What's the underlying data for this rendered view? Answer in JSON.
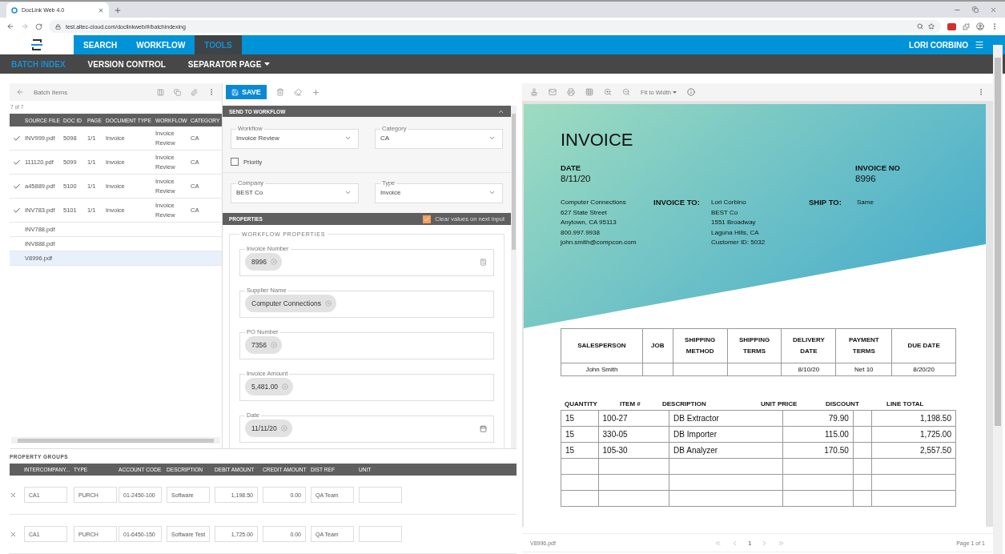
{
  "browser": {
    "tab_title": "DocLink Web 4.0",
    "url": "test.altec-cloud.com/doclinkweb/#/batchindexing"
  },
  "nav": {
    "items": [
      {
        "label": "SEARCH",
        "selected": false
      },
      {
        "label": "WORKFLOW",
        "selected": false
      },
      {
        "label": "TOOLS",
        "selected": true
      }
    ],
    "user": "LORI CORBINO"
  },
  "subnav": [
    {
      "label": "BATCH INDEX",
      "selected": true,
      "dropdown": false
    },
    {
      "label": "VERSION CONTROL",
      "selected": false,
      "dropdown": false
    },
    {
      "label": "SEPARATOR PAGE",
      "selected": false,
      "dropdown": true
    }
  ],
  "batch": {
    "title": "Batch Items",
    "count": "7 of 7",
    "columns": [
      "SOURCE FILE",
      "DOC ID",
      "PAGE",
      "DOCUMENT TYPE",
      "WORKFLOW",
      "CATEGORY"
    ],
    "rows": [
      {
        "checked": true,
        "selected": false,
        "cells": [
          "INV999.pdf",
          "5098",
          "1/1",
          "Invoice",
          "Invoice Review",
          "CA"
        ]
      },
      {
        "checked": true,
        "selected": false,
        "cells": [
          "111120.pdf",
          "5099",
          "1/1",
          "Invoice",
          "Invoice Review",
          "CA"
        ]
      },
      {
        "checked": true,
        "selected": false,
        "cells": [
          "a45889.pdf",
          "5100",
          "1/1",
          "Invoice",
          "Invoice Review",
          "CA"
        ]
      },
      {
        "checked": true,
        "selected": false,
        "cells": [
          "INV783.pdf",
          "5101",
          "1/1",
          "Invoice",
          "Invoice Review",
          "CA"
        ]
      },
      {
        "checked": false,
        "selected": false,
        "cells": [
          "INV788.pdf"
        ]
      },
      {
        "checked": false,
        "selected": false,
        "cells": [
          "INV888.pdf"
        ]
      },
      {
        "checked": false,
        "selected": true,
        "cells": [
          "V8996.pdf"
        ]
      }
    ]
  },
  "save": "SAVE",
  "send_to_workflow": {
    "title": "SEND TO WORKFLOW",
    "fields": [
      {
        "label": "Workflow",
        "value": "Invoice Review"
      },
      {
        "label": "Category",
        "value": "CA"
      },
      {
        "label": "Company",
        "value": "BEST Co"
      },
      {
        "label": "Type",
        "value": "Invoice"
      }
    ],
    "priority": {
      "label": "Priority",
      "checked": false
    }
  },
  "properties": {
    "title": "PROPERTIES",
    "clear_values": {
      "label": "Clear values on next input",
      "checked": true
    },
    "group_title": "WORKFLOW PROPERTIES",
    "fields": [
      {
        "label": "Invoice Number",
        "value": "8996",
        "kind": "number"
      },
      {
        "label": "Supplier Name",
        "value": "Computer Connections",
        "kind": "text"
      },
      {
        "label": "PO Number",
        "value": "7356",
        "kind": "text"
      },
      {
        "label": "Invoice Amount",
        "value": "5,481.00",
        "kind": "text"
      },
      {
        "label": "Date",
        "value": "11/11/20",
        "kind": "date"
      }
    ]
  },
  "property_groups": {
    "title": "PROPERTY GROUPS",
    "columns": [
      "INTERCOMPANY...",
      "TYPE",
      "ACCOUNT CODE",
      "DESCRIPTION",
      "DEBIT AMOUNT",
      "CREDIT AMOUNT",
      "DIST REF",
      "UNIT"
    ],
    "rows": [
      [
        "CA1",
        "PURCH",
        "01-2450-100",
        "Software",
        "1,198.50",
        "0.00",
        "QA Team",
        null
      ],
      [
        "CA1",
        "PURCH",
        "01-6450-150",
        "Software Test",
        "1,725.00",
        "0.00",
        "QA Team",
        null
      ]
    ]
  },
  "viewer": {
    "zoom": "Fit to Width",
    "file": "V8996.pdf",
    "page": "1",
    "page_info": "Page 1 of 1"
  },
  "invoice": {
    "title": "INVOICE",
    "date_label": "DATE",
    "date": "8/11/20",
    "invoice_no_label": "INVOICE NO",
    "invoice_no": "8996",
    "from": [
      "Computer Connections",
      "627 State Street",
      "Anytown, CA 95113",
      "800.997.9938",
      "john.smith@compcon.com"
    ],
    "invoice_to_label": "INVOICE TO:",
    "invoice_to": [
      "Lori Corbino",
      "BEST Co",
      "1551 Broadway",
      "Laguna Hills, CA",
      "Customer ID: 5032"
    ],
    "ship_to_label": "SHIP TO:",
    "ship_to": "Same",
    "summary": {
      "columns": [
        "SALESPERSON",
        "JOB",
        "SHIPPING METHOD",
        "SHIPPING TERMS",
        "DELIVERY DATE",
        "PAYMENT TERMS",
        "DUE DATE"
      ],
      "row": {
        "salesperson": "John Smith",
        "delivery_date": "8/10/20",
        "payment_terms": "Net 10",
        "due_date": "8/20/20"
      }
    },
    "items": {
      "columns": [
        "QUANTITY",
        "ITEM #",
        "DESCRIPTION",
        "UNIT PRICE",
        "DISCOUNT",
        "LINE TOTAL"
      ],
      "rows": [
        [
          "15",
          "100-27",
          "DB Extractor",
          "79.90",
          null,
          "1,198.50"
        ],
        [
          "15",
          "330-05",
          "DB Importer",
          "115.00",
          null,
          "1,725.00"
        ],
        [
          "15",
          "105-30",
          "DB Analyzer",
          "170.50",
          null,
          "2,557.50"
        ]
      ]
    }
  }
}
